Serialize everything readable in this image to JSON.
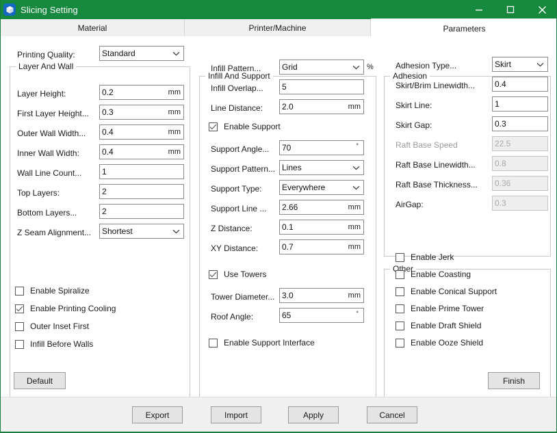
{
  "window": {
    "title": "Slicing Setting",
    "icon": "cube-icon",
    "accent_green": "#16893f",
    "controls": [
      {
        "name": "minimize",
        "glyph": "minimize-icon"
      },
      {
        "name": "maximize",
        "glyph": "maximize-icon"
      },
      {
        "name": "close",
        "glyph": "close-icon"
      }
    ]
  },
  "tabs": [
    {
      "label": "Material",
      "active": false
    },
    {
      "label": "Printer/Machine",
      "active": false
    },
    {
      "label": "Parameters",
      "active": true
    }
  ],
  "left_column": {
    "printing_quality": {
      "label": "Printing Quality:",
      "value": "Standard",
      "type": "combo"
    },
    "group": {
      "title": "Layer And Wall",
      "fields": [
        {
          "label": "Layer Height:",
          "value": "0.2",
          "unit": "mm",
          "type": "text"
        },
        {
          "label": "First Layer Height...",
          "value": "0.3",
          "unit": "mm",
          "type": "text"
        },
        {
          "label": "Outer Wall Width...",
          "value": "0.4",
          "unit": "mm",
          "type": "text"
        },
        {
          "label": "Inner Wall Width:",
          "value": "0.4",
          "unit": "mm",
          "type": "text"
        },
        {
          "label": "Wall Line Count...",
          "value": "1",
          "unit": "",
          "type": "text"
        },
        {
          "label": "Top Layers:",
          "value": "2",
          "unit": "",
          "type": "text"
        },
        {
          "label": "Bottom Layers...",
          "value": "2",
          "unit": "",
          "type": "text"
        },
        {
          "label": "Z Seam Alignment...",
          "value": "Shortest",
          "unit": "",
          "type": "combo"
        }
      ],
      "checkboxes": [
        {
          "label": "Enable Spiralize",
          "checked": false
        },
        {
          "label": "Enable Printing Cooling",
          "checked": true
        },
        {
          "label": "Outer Inset First",
          "checked": false
        },
        {
          "label": "Infill Before Walls",
          "checked": false
        }
      ]
    }
  },
  "middle_column": {
    "group": {
      "title": "Infill And Support",
      "rows": [
        {
          "label": "Infill Pattern...",
          "value": "Grid",
          "unit": "",
          "outside_unit": "%",
          "type": "combo"
        },
        {
          "label": "Infill Overlap...",
          "value": "5",
          "unit": "",
          "type": "text"
        },
        {
          "label": "Line Distance:",
          "value": "2.0",
          "unit": "mm",
          "type": "text"
        },
        {
          "label": "Enable Support",
          "checked": true,
          "type": "check"
        },
        {
          "label": "Support Angle...",
          "value": "70",
          "unit": "°",
          "type": "text"
        },
        {
          "label": "Support Pattern...",
          "value": "Lines",
          "unit": "",
          "type": "combo"
        },
        {
          "label": "Support Type:",
          "value": "Everywhere",
          "unit": "",
          "type": "combo"
        },
        {
          "label": "Support Line ...",
          "value": "2.66",
          "unit": "mm",
          "type": "text"
        },
        {
          "label": "Z Distance:",
          "value": "0.1",
          "unit": "mm",
          "type": "text"
        },
        {
          "label": "XY Distance:",
          "value": "0.7",
          "unit": "mm",
          "type": "text"
        },
        {
          "label": "Use Towers",
          "checked": true,
          "type": "check"
        },
        {
          "label": "Tower Diameter...",
          "value": "3.0",
          "unit": "mm",
          "type": "text"
        },
        {
          "label": "Roof Angle:",
          "value": "65",
          "unit": "°",
          "type": "text"
        },
        {
          "label": "Enable Support Interface",
          "checked": false,
          "type": "check"
        }
      ]
    }
  },
  "right_column": {
    "adhesion": {
      "title": "Adhesion",
      "fields": [
        {
          "label": "Adhesion Type...",
          "value": "Skirt",
          "type": "combo",
          "disabled": false,
          "label_disabled": false
        },
        {
          "label": "Skirt/Brim Linewidth...",
          "value": "0.4",
          "type": "text",
          "disabled": false,
          "label_disabled": false
        },
        {
          "label": "Skirt Line:",
          "value": "1",
          "type": "text",
          "disabled": false,
          "label_disabled": false
        },
        {
          "label": "Skirt Gap:",
          "value": "0.3",
          "type": "text",
          "disabled": false,
          "label_disabled": false
        },
        {
          "label": "Raft Base Speed",
          "value": "22.5",
          "type": "text",
          "disabled": true,
          "label_disabled": true
        },
        {
          "label": "Raft Base Linewidth...",
          "value": "0.8",
          "type": "text",
          "disabled": true,
          "label_disabled": false
        },
        {
          "label": "Raft Base Thickness...",
          "value": "0.36",
          "type": "text",
          "disabled": true,
          "label_disabled": false
        },
        {
          "label": "AirGap:",
          "value": "0.3",
          "type": "text",
          "disabled": true,
          "label_disabled": false
        }
      ]
    },
    "other": {
      "title": "Other",
      "checkboxes": [
        {
          "label": "Enable Jerk",
          "checked": false
        },
        {
          "label": "Enable Coasting",
          "checked": false
        },
        {
          "label": "Enable Conical Support",
          "checked": false
        },
        {
          "label": "Enable Prime Tower",
          "checked": false
        },
        {
          "label": "Enable Draft Shield",
          "checked": false
        },
        {
          "label": "Enable Ooze Shield",
          "checked": false
        }
      ]
    }
  },
  "actions": {
    "default_label": "Default",
    "finish_label": "Finish"
  },
  "footer": {
    "buttons": [
      {
        "label": "Export"
      },
      {
        "label": "Import"
      },
      {
        "label": "Apply"
      },
      {
        "label": "Cancel"
      }
    ]
  }
}
